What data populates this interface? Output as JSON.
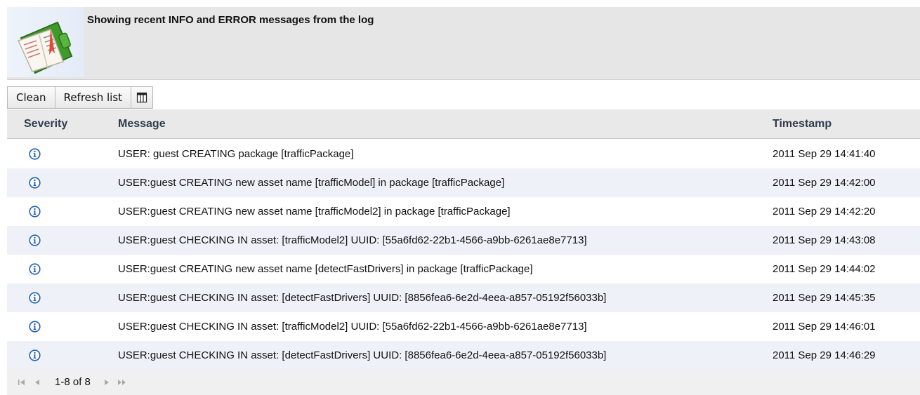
{
  "header": {
    "title": "Showing recent INFO and ERROR messages from the log",
    "logo_icon": "log-book-icon"
  },
  "toolbar": {
    "clean_label": "Clean",
    "refresh_label": "Refresh list",
    "columns_icon": "columns-icon"
  },
  "table": {
    "columns": {
      "severity": "Severity",
      "message": "Message",
      "timestamp": "Timestamp"
    },
    "rows": [
      {
        "severity": "info",
        "message": "USER: guest CREATING package [trafficPackage]",
        "timestamp": "2011 Sep 29 14:41:40"
      },
      {
        "severity": "info",
        "message": "USER:guest CREATING new asset name [trafficModel] in package [trafficPackage]",
        "timestamp": "2011 Sep 29 14:42:00"
      },
      {
        "severity": "info",
        "message": "USER:guest CREATING new asset name [trafficModel2] in package [trafficPackage]",
        "timestamp": "2011 Sep 29 14:42:20"
      },
      {
        "severity": "info",
        "message": "USER:guest CHECKING IN asset: [trafficModel2] UUID: [55a6fd62-22b1-4566-a9bb-6261ae8e7713]",
        "timestamp": "2011 Sep 29 14:43:08"
      },
      {
        "severity": "info",
        "message": "USER:guest CREATING new asset name [detectFastDrivers] in package [trafficPackage]",
        "timestamp": "2011 Sep 29 14:44:02"
      },
      {
        "severity": "info",
        "message": "USER:guest CHECKING IN asset: [detectFastDrivers] UUID: [8856fea6-6e2d-4eea-a857-05192f56033b]",
        "timestamp": "2011 Sep 29 14:45:35"
      },
      {
        "severity": "info",
        "message": "USER:guest CHECKING IN asset: [trafficModel2] UUID: [55a6fd62-22b1-4566-a9bb-6261ae8e7713]",
        "timestamp": "2011 Sep 29 14:46:01"
      },
      {
        "severity": "info",
        "message": "USER:guest CHECKING IN asset: [detectFastDrivers] UUID: [8856fea6-6e2d-4eea-a857-05192f56033b]",
        "timestamp": "2011 Sep 29 14:46:29"
      }
    ]
  },
  "pager": {
    "range_text": "1-8 of 8"
  },
  "colors": {
    "info_icon": "#1f5fb8",
    "row_alt": "#eef2f8",
    "header_bg": "#e6e6e6"
  }
}
